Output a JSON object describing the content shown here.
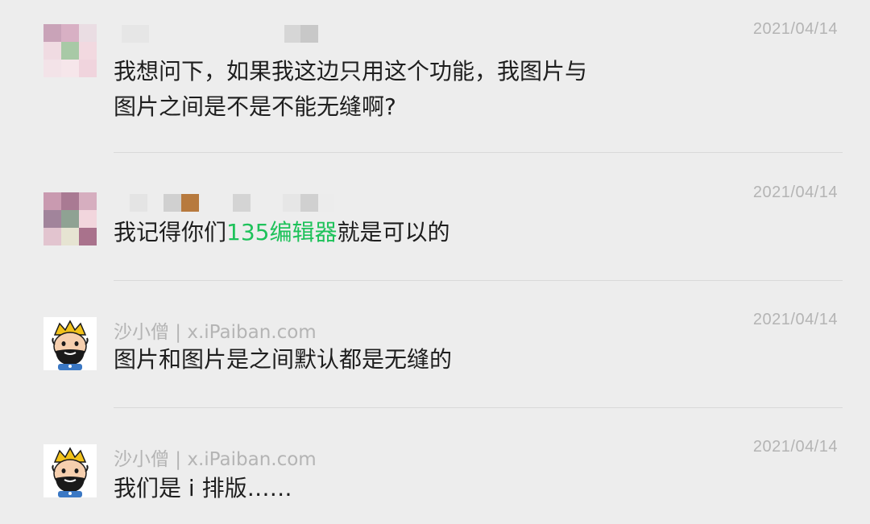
{
  "messages": [
    {
      "name": "",
      "date": "2021/04/14",
      "lines": [
        "我想问下，如果我这边只用这个功能，我图片与",
        "图片之间是不是不能无缝啊?"
      ]
    },
    {
      "name": "",
      "date": "2021/04/14",
      "text_before": "我记得你们",
      "highlight": "135编辑器",
      "text_after": "就是可以的"
    },
    {
      "name": "沙小僧 | x.iPaiban.com",
      "date": "2021/04/14",
      "text": "图片和图片是之间默认都是无缝的"
    },
    {
      "name": "沙小僧 | x.iPaiban.com",
      "date": "2021/04/14",
      "text": "我们是 i 排版……"
    }
  ],
  "colors": {
    "background": "#ededed",
    "highlight": "#1ec25a",
    "meta": "#b4b4b4",
    "text": "#1e1e1e"
  },
  "icons": {
    "avatar_blurred": "pixelated-avatar",
    "avatar_monk": "monk-cartoon-avatar"
  }
}
